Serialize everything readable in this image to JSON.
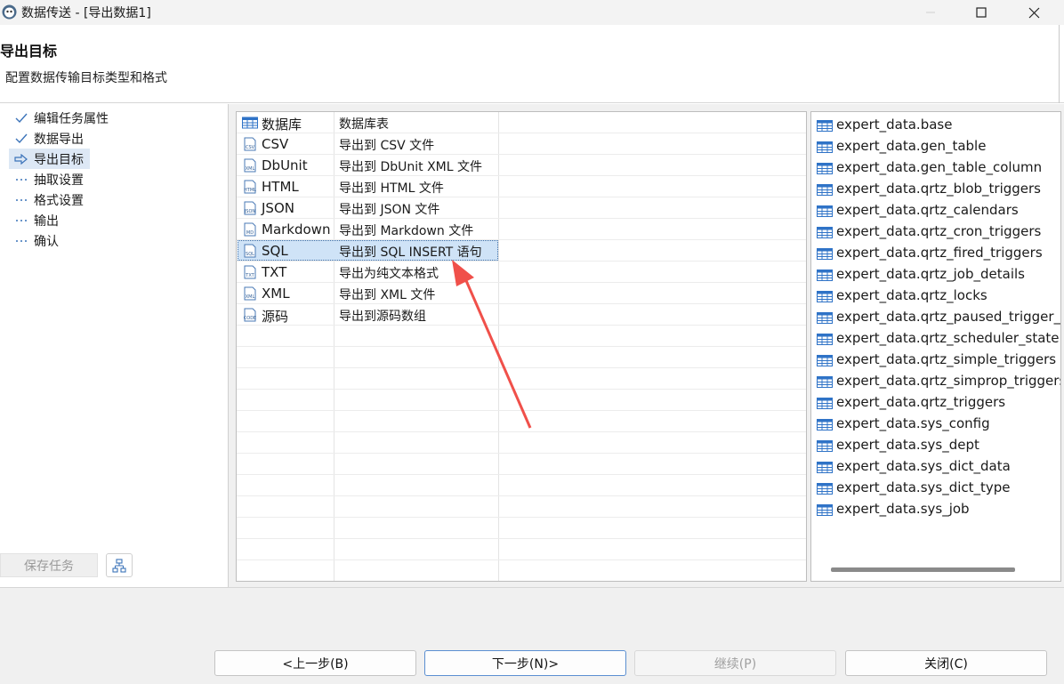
{
  "window": {
    "title": "数据传送 - [导出数据1]",
    "controls": [
      "minimize",
      "maximize",
      "close"
    ]
  },
  "header": {
    "title": "导出目标",
    "subtitle": "配置数据传输目标类型和格式"
  },
  "steps": [
    {
      "label": "编辑任务属性",
      "state": "done",
      "icon": "check-icon"
    },
    {
      "label": "数据导出",
      "state": "done",
      "icon": "check-icon"
    },
    {
      "label": "导出目标",
      "state": "current",
      "icon": "arrow-right-icon"
    },
    {
      "label": "抽取设置",
      "state": "pending",
      "icon": "dots-icon"
    },
    {
      "label": "格式设置",
      "state": "pending",
      "icon": "dots-icon"
    },
    {
      "label": "输出",
      "state": "pending",
      "icon": "dots-icon"
    },
    {
      "label": "确认",
      "state": "pending",
      "icon": "dots-icon"
    }
  ],
  "sidebar": {
    "save_task_label": "保存任务"
  },
  "formats": [
    {
      "name": "数据库",
      "desc": "数据库表",
      "icon": "table-icon"
    },
    {
      "name": "CSV",
      "desc": "导出到 CSV 文件",
      "icon": "csv-file-icon"
    },
    {
      "name": "DbUnit",
      "desc": "导出到 DbUnit XML 文件",
      "icon": "xml-file-icon"
    },
    {
      "name": "HTML",
      "desc": "导出到 HTML 文件",
      "icon": "html-file-icon"
    },
    {
      "name": "JSON",
      "desc": "导出到 JSON 文件",
      "icon": "json-file-icon"
    },
    {
      "name": "Markdown",
      "desc": "导出到 Markdown 文件",
      "icon": "markdown-file-icon"
    },
    {
      "name": "SQL",
      "desc": "导出到 SQL INSERT 语句",
      "icon": "sql-file-icon",
      "selected": true
    },
    {
      "name": "TXT",
      "desc": "导出为纯文本格式",
      "icon": "txt-file-icon"
    },
    {
      "name": "XML",
      "desc": "导出到 XML 文件",
      "icon": "xml-file-icon"
    },
    {
      "name": "源码",
      "desc": "导出到源码数组",
      "icon": "code-file-icon"
    }
  ],
  "tables": [
    "expert_data.base",
    "expert_data.gen_table",
    "expert_data.gen_table_column",
    "expert_data.qrtz_blob_triggers",
    "expert_data.qrtz_calendars",
    "expert_data.qrtz_cron_triggers",
    "expert_data.qrtz_fired_triggers",
    "expert_data.qrtz_job_details",
    "expert_data.qrtz_locks",
    "expert_data.qrtz_paused_trigger_g",
    "expert_data.qrtz_scheduler_state",
    "expert_data.qrtz_simple_triggers",
    "expert_data.qrtz_simprop_triggers",
    "expert_data.qrtz_triggers",
    "expert_data.sys_config",
    "expert_data.sys_dept",
    "expert_data.sys_dict_data",
    "expert_data.sys_dict_type",
    "expert_data.sys_job"
  ],
  "footer": {
    "back_label": "<上一步(B)",
    "next_label": "下一步(N)>",
    "continue_label": "继续(P)",
    "close_label": "关闭(C)"
  },
  "colors": {
    "selection": "#cfe3f7",
    "annotation_arrow": "#f0504a",
    "table_icon": "#2f73c7"
  }
}
